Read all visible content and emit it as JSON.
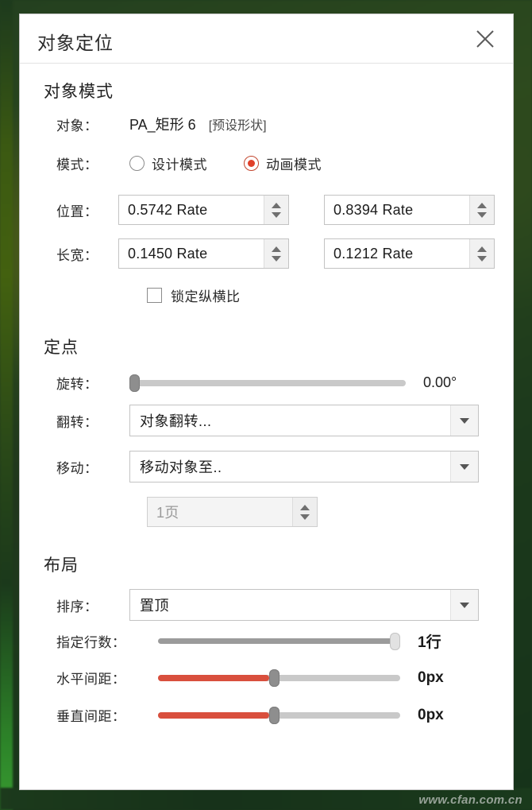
{
  "window": {
    "title": "对象定位",
    "close_icon": "close-icon"
  },
  "watermark": "www.cfan.com.cn",
  "colors": {
    "accent_red": "#d94f3d",
    "radio_red": "#e0402a",
    "track_gray": "#c9c9c9",
    "track_dark": "#9b9b9b",
    "backdrop_green": "#24401f"
  },
  "object_mode": {
    "section_title": "对象模式",
    "object_label": "对象：",
    "object_name": "PA_矩形 6",
    "object_type": "[预设形状]",
    "mode_label": "模式：",
    "modes": [
      {
        "label": "设计模式",
        "selected": false
      },
      {
        "label": "动画模式",
        "selected": true
      }
    ],
    "position_label": "位置：",
    "position_x": "0.5742 Rate",
    "position_y": "0.8394 Rate",
    "size_label": "长宽：",
    "size_w": "0.1450 Rate",
    "size_h": "0.1212 Rate",
    "lock_ratio_label": "锁定纵横比",
    "lock_ratio_checked": false
  },
  "anchor": {
    "section_title": "定点",
    "rotate_label": "旋转：",
    "rotate_value": "0.00°",
    "rotate_percent": 0,
    "flip_label": "翻转：",
    "flip_value": "对象翻转...",
    "move_label": "移动：",
    "move_value": "移动对象至..",
    "page_value": "1页",
    "page_disabled": true
  },
  "layout": {
    "section_title": "布局",
    "order_label": "排序：",
    "order_value": "置顶",
    "sliders": [
      {
        "label": "指定行数：",
        "value": "1行",
        "percent": 100,
        "filled": false,
        "track": "dark"
      },
      {
        "label": "水平间距：",
        "value": "0px",
        "percent": 46,
        "filled": true,
        "track": "light"
      },
      {
        "label": "垂直间距：",
        "value": "0px",
        "percent": 46,
        "filled": true,
        "track": "light"
      }
    ]
  }
}
